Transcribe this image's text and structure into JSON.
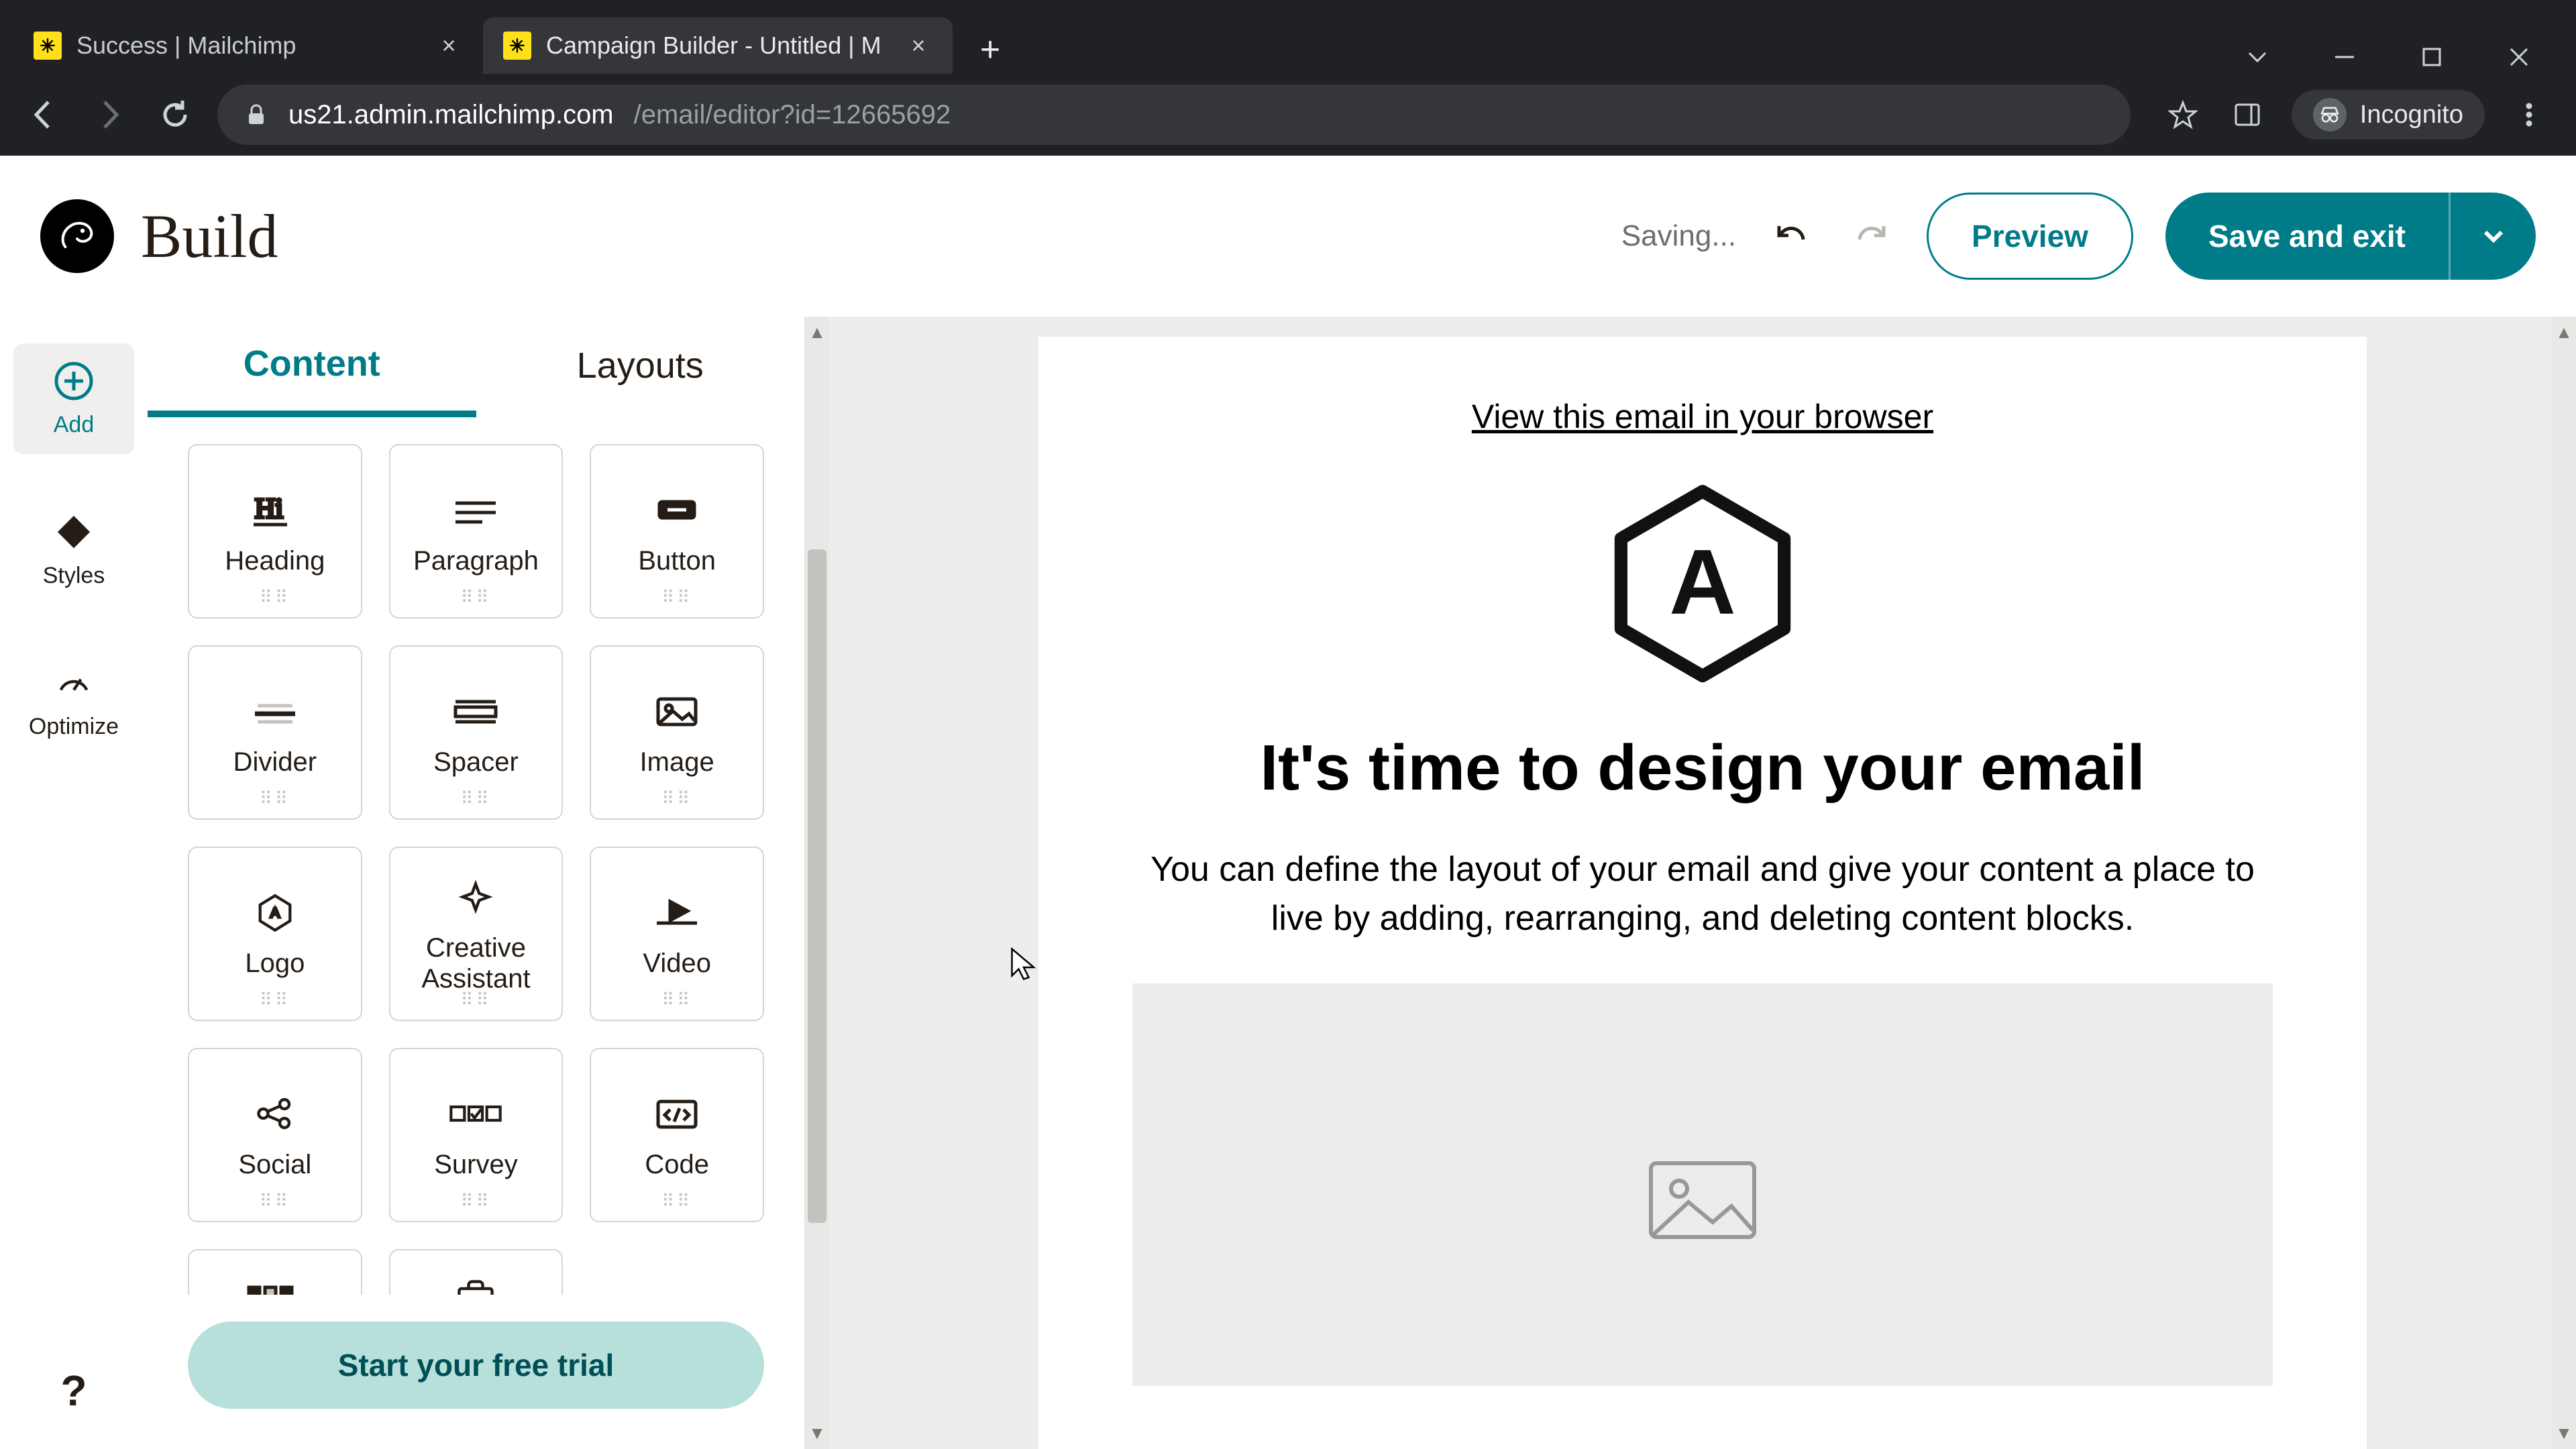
{
  "browser": {
    "tabs": [
      {
        "title": "Success | Mailchimp",
        "active": false
      },
      {
        "title": "Campaign Builder - Untitled | M",
        "active": true
      }
    ],
    "url_host": "us21.admin.mailchimp.com",
    "url_path": "/email/editor?id=12665692",
    "incognito_label": "Incognito"
  },
  "header": {
    "title": "Build",
    "status": "Saving...",
    "preview": "Preview",
    "save": "Save and exit"
  },
  "nav_rail": {
    "add": "Add",
    "styles": "Styles",
    "optimize": "Optimize",
    "help": "?"
  },
  "side_panel": {
    "tabs": {
      "content": "Content",
      "layouts": "Layouts"
    },
    "blocks": {
      "heading": "Heading",
      "paragraph": "Paragraph",
      "button": "Button",
      "divider": "Divider",
      "spacer": "Spacer",
      "image": "Image",
      "logo": "Logo",
      "creative": "Creative Assistant",
      "video": "Video",
      "social": "Social",
      "survey": "Survey",
      "code": "Code"
    },
    "trial_cta": "Start your free trial"
  },
  "canvas": {
    "view_link": "View this email in your browser",
    "heading": "It's time to design your email",
    "lead": "You can define the layout of your email and give your content a place to live by adding, rearranging, and deleting content blocks.",
    "logo_letter": "A"
  }
}
